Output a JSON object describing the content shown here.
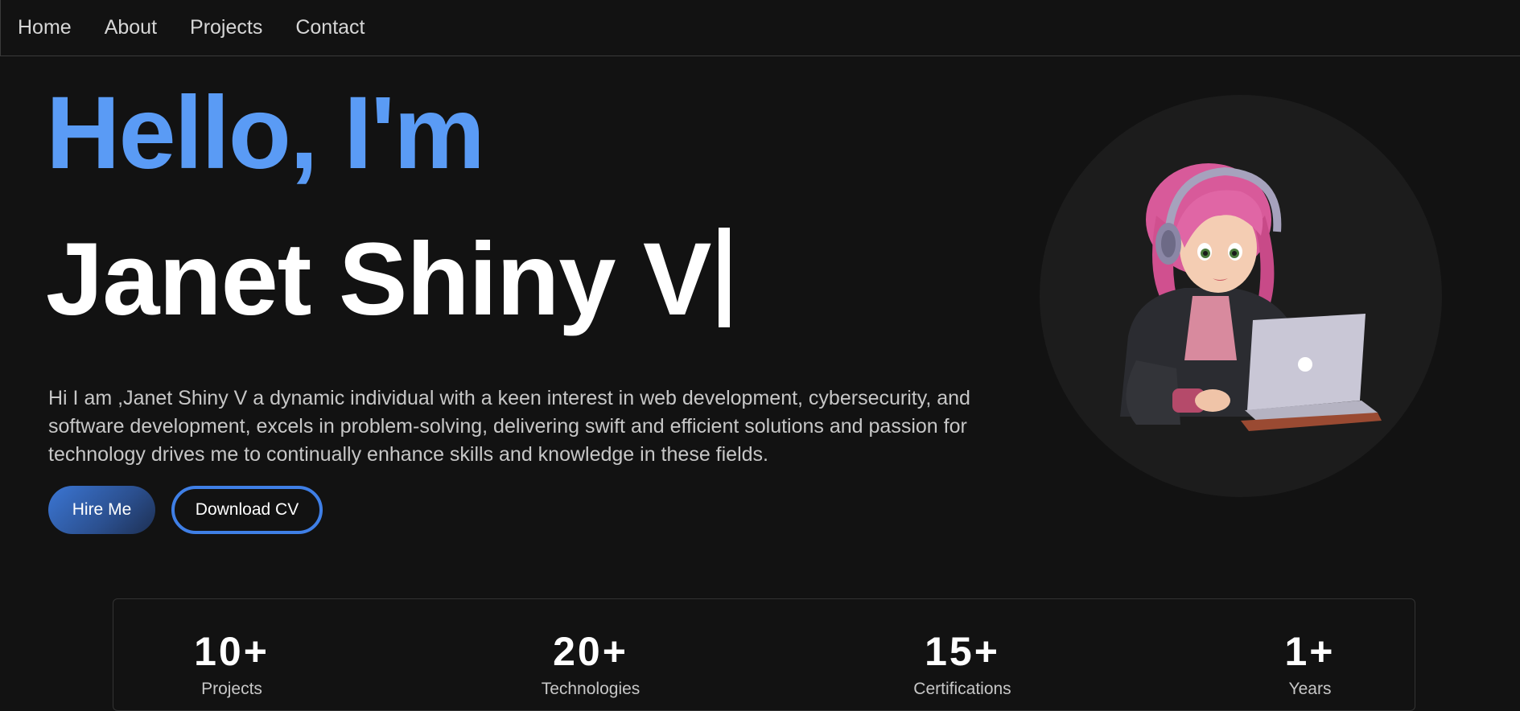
{
  "nav": {
    "items": [
      {
        "label": "Home"
      },
      {
        "label": "About"
      },
      {
        "label": "Projects"
      },
      {
        "label": "Contact"
      }
    ]
  },
  "hero": {
    "greeting": "Hello, I'm",
    "name": "Janet Shiny V",
    "bio": "Hi I am ,Janet Shiny V a dynamic individual with a keen interest in web development, cybersecurity, and software development, excels in problem-solving, delivering swift and efficient solutions and passion for technology drives me to continually enhance skills and knowledge in these fields.",
    "hire_label": "Hire Me",
    "cv_label": "Download CV"
  },
  "stats": [
    {
      "value": "10+",
      "label": "Projects"
    },
    {
      "value": "20+",
      "label": "Technologies"
    },
    {
      "value": "15+",
      "label": "Certifications"
    },
    {
      "value": "1+",
      "label": "Years"
    }
  ],
  "colors": {
    "accent": "#5a9bf5",
    "background": "#121212",
    "button_border": "#3f7fe6"
  },
  "icons": {
    "avatar": "developer-girl-laptop-illustration"
  }
}
